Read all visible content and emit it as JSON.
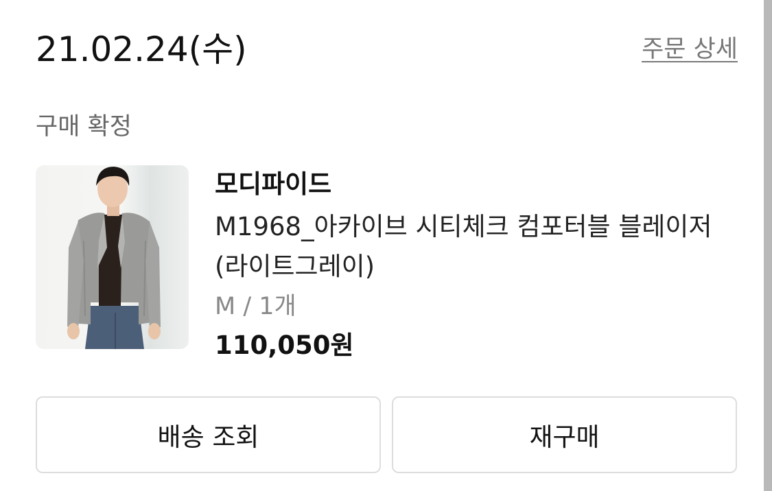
{
  "order": {
    "date": "21.02.24(수)",
    "detail_link": "주문 상세",
    "status": "구매 확정"
  },
  "product": {
    "brand": "모디파이드",
    "name": "M1968_아카이브 시티체크 컴포터블 블레이저 (라이트그레이)",
    "option": "M / 1개",
    "price": "110,050원"
  },
  "actions": {
    "track_label": "배송 조회",
    "rebuy_label": "재구매"
  },
  "colors": {
    "text_primary": "#111111",
    "text_secondary": "#666666",
    "text_muted": "#888888",
    "border": "#dddddd",
    "scrollbar": "#b9b9b9"
  }
}
